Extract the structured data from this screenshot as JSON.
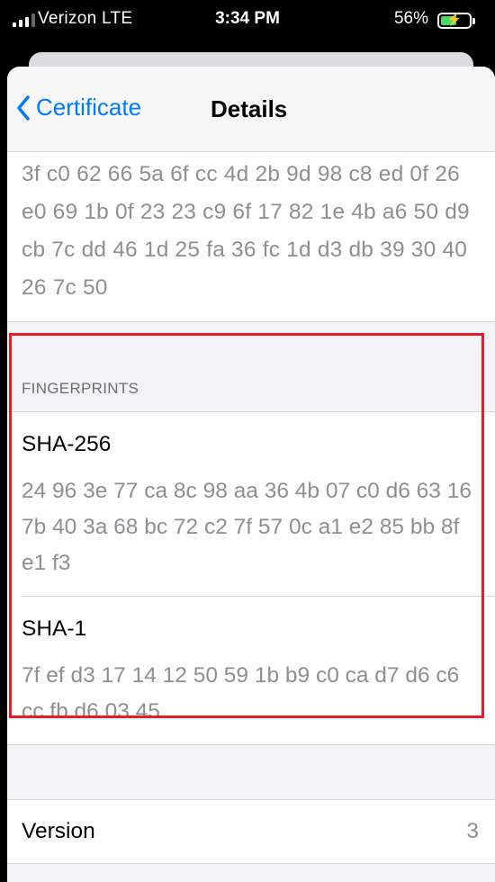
{
  "status_bar": {
    "carrier": "Verizon  LTE",
    "time": "3:34 PM",
    "battery_percent": "56%",
    "battery_level": 0.56,
    "battery_color": "#4cd964"
  },
  "nav": {
    "back_label": "Certificate",
    "title": "Details",
    "accent": "#007aff"
  },
  "top_hex_value": "3f c0 62 66 5a 6f cc 4d 2b 9d 98 c8 ed 0f 26 e0 69 1b 0f 23 23 c9 6f 17 82 1e 4b a6 50 d9 cb 7c dd 46 1d 25 fa 36 fc 1d d3 db 39 30 40 26 7c 50",
  "fingerprints": {
    "header": "FINGERPRINTS",
    "items": [
      {
        "title": "SHA-256",
        "value": "24 96 3e 77 ca 8c 98 aa 36 4b 07 c0 d6 63 16 7b 40 3a 68 bc 72 c2 7f 57 0c a1 e2 85 bb 8f e1 f3"
      },
      {
        "title": "SHA-1",
        "value": "7f ef d3 17 14 12 50 59 1b b9 c0 ca d7 d6 c6 cc fb d6 03 45"
      }
    ]
  },
  "version": {
    "label": "Version",
    "value": "3"
  },
  "annotation_color": "#e01f27"
}
